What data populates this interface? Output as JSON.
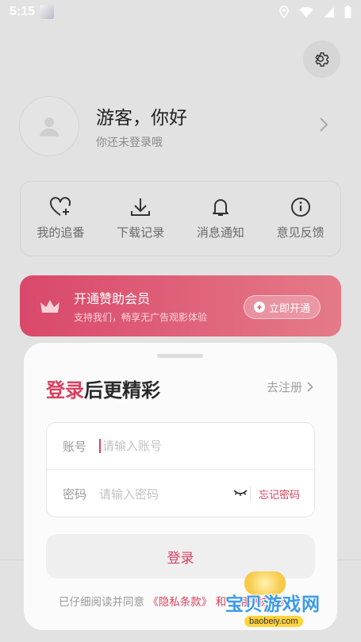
{
  "status_bar": {
    "time": "5:15"
  },
  "profile": {
    "greeting": "游客，你好",
    "sub": "你还未登录哦"
  },
  "quick_actions": [
    {
      "label": "我的追番",
      "icon": "heart-plus-icon"
    },
    {
      "label": "下载记录",
      "icon": "download-icon"
    },
    {
      "label": "消息通知",
      "icon": "bell-icon"
    },
    {
      "label": "意见反馈",
      "icon": "info-icon"
    }
  ],
  "vip": {
    "title": "开通赞助会员",
    "sub": "支持我们，畅享无广告观影体验",
    "button": "立即开通"
  },
  "login_sheet": {
    "title_accent": "登录",
    "title_rest": "后更精彩",
    "register": "去注册",
    "account_label": "账号",
    "account_placeholder": "请输入账号",
    "password_label": "密码",
    "password_placeholder": "请输入密码",
    "forgot": "忘记密码",
    "login_button": "登录",
    "agreement_prefix": "已仔细阅读并同意",
    "privacy_link": "《隐私条款》",
    "agreement_tail": "和《用户协议》"
  },
  "watermark": {
    "text": "宝贝游戏网",
    "url": "baobeiy.com"
  },
  "colors": {
    "accent": "#d9405f",
    "vip_gradient_start": "#d9486a",
    "vip_gradient_end": "#e57a88"
  }
}
